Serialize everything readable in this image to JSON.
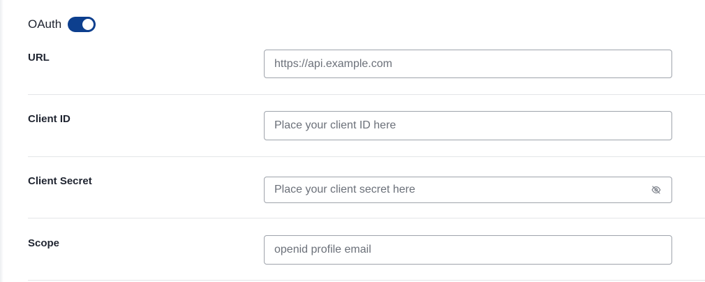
{
  "oauth": {
    "label": "OAuth",
    "enabled": true
  },
  "fields": {
    "url": {
      "label": "URL",
      "placeholder": "https://api.example.com",
      "value": ""
    },
    "client_id": {
      "label": "Client ID",
      "placeholder": "Place your client ID here",
      "value": ""
    },
    "client_secret": {
      "label": "Client Secret",
      "placeholder": "Place your client secret here",
      "value": ""
    },
    "scope": {
      "label": "Scope",
      "placeholder": "openid profile email",
      "value": ""
    }
  },
  "icons": {
    "secret_visibility": "eye-off-icon"
  },
  "colors": {
    "toggle_on": "#0d3f8e",
    "input_border": "#9ea3ab",
    "divider": "#e3e5e8"
  }
}
